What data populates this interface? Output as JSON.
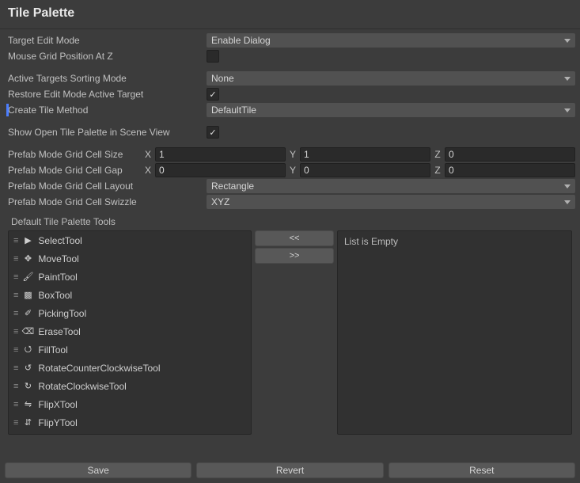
{
  "title": "Tile Palette",
  "labels": {
    "targetEditMode": "Target Edit Mode",
    "mouseGridZ": "Mouse Grid Position At Z",
    "activeTargetsSort": "Active Targets Sorting Mode",
    "restoreEditTarget": "Restore Edit Mode Active Target",
    "createTileMethod": "Create Tile Method",
    "showOpenPalette": "Show Open Tile Palette in Scene View",
    "prefabCellSize": "Prefab Mode Grid Cell Size",
    "prefabCellGap": "Prefab Mode Grid Cell Gap",
    "prefabCellLayout": "Prefab Mode Grid Cell Layout",
    "prefabCellSwizzle": "Prefab Mode Grid Cell Swizzle",
    "defaultTools": "Default Tile Palette Tools"
  },
  "dropdowns": {
    "targetEditMode": "Enable Dialog",
    "activeTargetsSort": "None",
    "createTileMethod": "DefaultTile",
    "prefabCellLayout": "Rectangle",
    "prefabCellSwizzle": "XYZ"
  },
  "checkboxes": {
    "mouseGridZ": false,
    "restoreEditTarget": true,
    "showOpenPalette": true
  },
  "axes": {
    "x": "X",
    "y": "Y",
    "z": "Z"
  },
  "cellSize": {
    "x": "1",
    "y": "1",
    "z": "0"
  },
  "cellGap": {
    "x": "0",
    "y": "0",
    "z": "0"
  },
  "tools": [
    {
      "name": "SelectTool",
      "iconKey": "select"
    },
    {
      "name": "MoveTool",
      "iconKey": "move"
    },
    {
      "name": "PaintTool",
      "iconKey": "paint"
    },
    {
      "name": "BoxTool",
      "iconKey": "box"
    },
    {
      "name": "PickingTool",
      "iconKey": "pick"
    },
    {
      "name": "EraseTool",
      "iconKey": "erase"
    },
    {
      "name": "FillTool",
      "iconKey": "fill"
    },
    {
      "name": "RotateCounterClockwiseTool",
      "iconKey": "rotccw"
    },
    {
      "name": "RotateClockwiseTool",
      "iconKey": "rotcw"
    },
    {
      "name": "FlipXTool",
      "iconKey": "flipx"
    },
    {
      "name": "FlipYTool",
      "iconKey": "flipy"
    }
  ],
  "moveButtons": {
    "left": "<<",
    "right": ">>"
  },
  "rightListText": "List is Empty",
  "footer": {
    "save": "Save",
    "revert": "Revert",
    "reset": "Reset"
  }
}
